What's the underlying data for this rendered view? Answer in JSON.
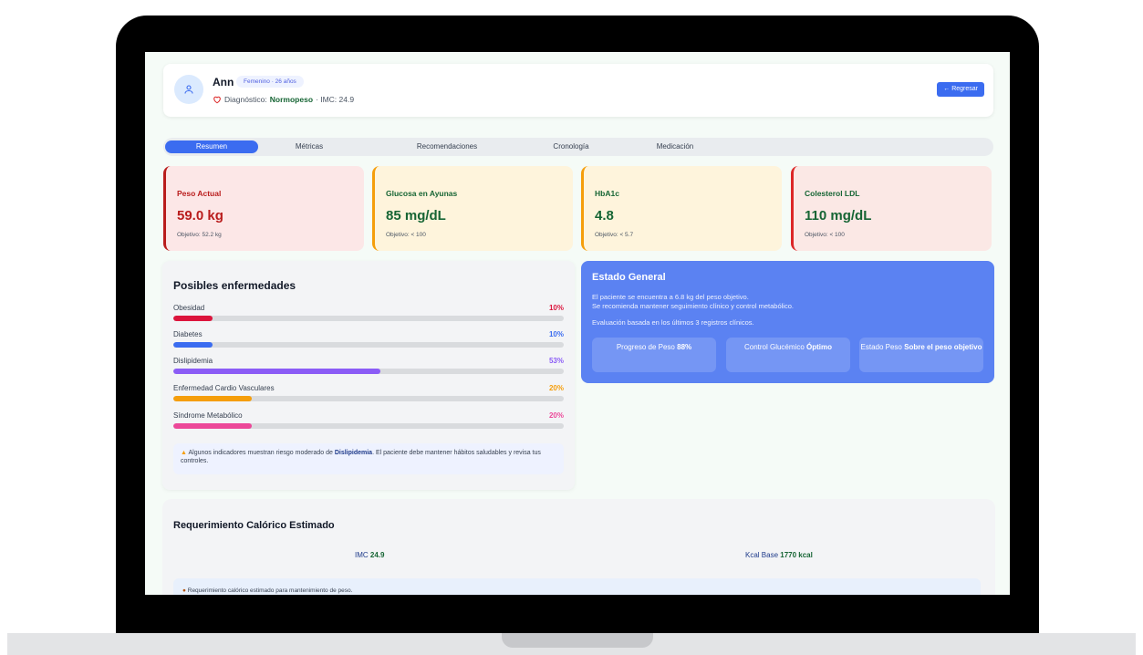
{
  "patient": {
    "name": "Ann",
    "badge": "Femenino · 26 años",
    "diagnosis_label": "Diagnóstico:",
    "diagnosis_value": "Normopeso",
    "imc_text": "· IMC: 24.9",
    "back_label": "← Regresar"
  },
  "tabs": [
    "Resumen",
    "Métricas",
    "Recomendaciones",
    "Cronología",
    "Medicación"
  ],
  "metrics": [
    {
      "label": "Peso Actual",
      "value": "59.0 kg",
      "target": "Objetivo: 52.2 kg",
      "color": "#b91c1c",
      "bg": "#fce7e7"
    },
    {
      "label": "Glucosa en Ayunas",
      "value": "85 mg/dL",
      "target": "Objetivo: < 100",
      "color": "#166534",
      "bg": "#fef4dc"
    },
    {
      "label": "HbA1c",
      "value": "4.8",
      "target": "Objetivo: < 5.7",
      "color": "#166534",
      "bg": "#fef4dc"
    },
    {
      "label": "Colesterol LDL",
      "value": "110 mg/dL",
      "target": "Objetivo: < 100",
      "color": "#166534",
      "bg": "#fbe8e5"
    }
  ],
  "diseases": {
    "title": "Posibles enfermedades",
    "items": [
      {
        "name": "Obesidad",
        "pct": "10%",
        "value": 10,
        "color": "#dc143c"
      },
      {
        "name": "Diabetes",
        "pct": "10%",
        "value": 10,
        "color": "#3b6cf0"
      },
      {
        "name": "Dislipidemia",
        "pct": "53%",
        "value": 53,
        "color": "#8b5cf6"
      },
      {
        "name": "Enfermedad Cardio Vasculares",
        "pct": "20%",
        "value": 20,
        "color": "#f59e0b"
      },
      {
        "name": "Síndrome Metabólico",
        "pct": "20%",
        "value": 20,
        "color": "#ec4899"
      }
    ],
    "alert_prefix": "Algunos indicadores muestran riesgo moderado de",
    "alert_bold": "Dislipidemia",
    "alert_suffix": ". El paciente debe mantener hábitos saludables y revisa tus controles."
  },
  "estado": {
    "title": "Estado General",
    "line1": "El paciente se encuentra a 6.8 kg del peso objetivo.",
    "line2": "Se recomienda mantener seguimiento clínico y control metabólico.",
    "line3": "Evaluación basada en los últimos 3 registros clínicos.",
    "stat1_label": "Progreso de Peso",
    "stat1_value": "88%",
    "stat2_label": "Control Glucémico",
    "stat2_value": "Óptimo",
    "stat3_label": "Estado Peso",
    "stat3_value": "Sobre el peso objetivo"
  },
  "caloric": {
    "title": "Requerimiento Calórico Estimado",
    "imc_label": "IMC",
    "imc_value": "24.9",
    "kcal_label": "Kcal Base",
    "kcal_value": "1770 kcal",
    "note": "Requerimiento calórico estimado para mantenimiento de peso."
  }
}
